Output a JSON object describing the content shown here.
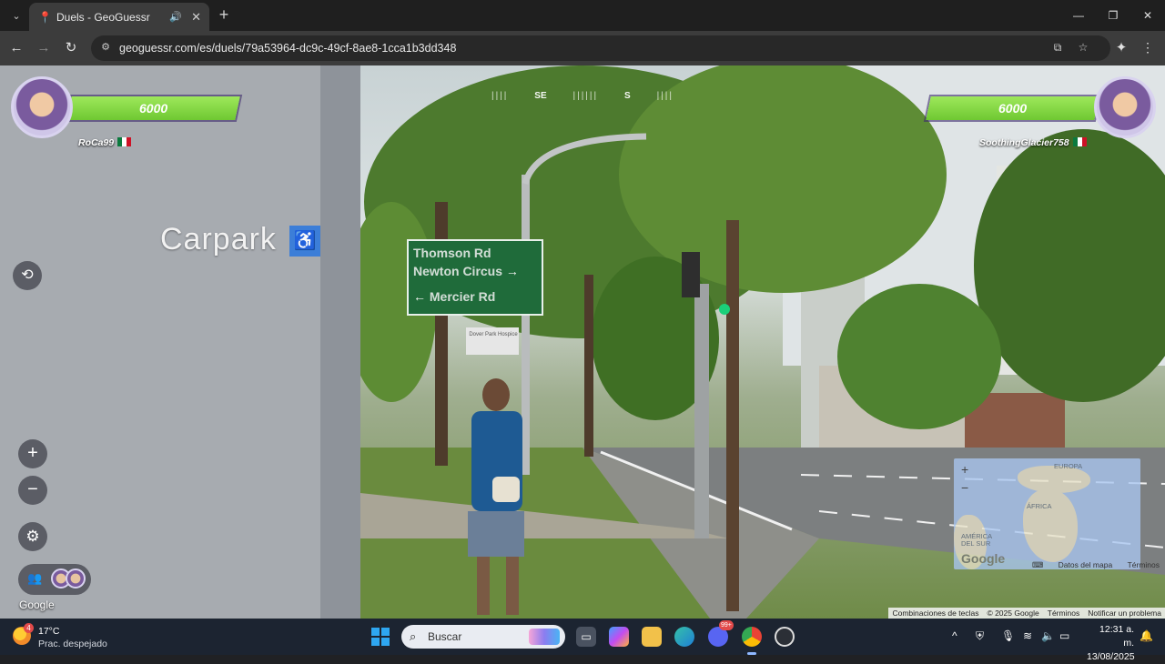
{
  "browser": {
    "tab_title": "Duels - GeoGuessr",
    "url": "geoguessr.com/es/duels/79a53964-dc9c-49cf-8ae8-1cca1b3dd348",
    "icons": [
      "tab-search-icon",
      "audio-icon",
      "close-icon",
      "new-tab-icon",
      "back-icon",
      "forward-icon",
      "reload-icon",
      "site-info-icon",
      "install-app-icon",
      "bookmark-star-icon",
      "extension-icon",
      "menu-icon"
    ]
  },
  "game": {
    "compass": {
      "left": "SE",
      "right": "S"
    },
    "player1": {
      "name": "RoCa99",
      "health": "6000"
    },
    "player2": {
      "name": "SoothingGlacier758",
      "health": "6000"
    },
    "scene_text": {
      "carpark": "Carpark",
      "sign_line1": "Thomson Rd",
      "sign_line2": "Newton Circus",
      "sign_line3": "Mercier Rd",
      "small_sign": "Dover Park Hospice"
    },
    "google_logo": "Google",
    "minimap": {
      "europa": "EUROPA",
      "africa": "ÁFRICA",
      "south_america": "AMÉRICA DEL SUR",
      "google": "Google",
      "map_data": "Datos del mapa",
      "terms": "Términos"
    },
    "attribution": {
      "shortcuts": "Combinaciones de teclas",
      "copyright": "© 2025 Google",
      "terms": "Términos",
      "report": "Notificar un problema"
    }
  },
  "taskbar": {
    "weather": {
      "temp": "17°C",
      "cond": "Prac. despejado",
      "badge": "4"
    },
    "search_placeholder": "Buscar",
    "discord_badge": "99+",
    "time": "12:31 a. m.",
    "date": "13/08/2025"
  },
  "colors": {
    "health_green": "#7fd842",
    "tab_bg": "#3c3c3c",
    "taskbar": "#1c2431"
  }
}
